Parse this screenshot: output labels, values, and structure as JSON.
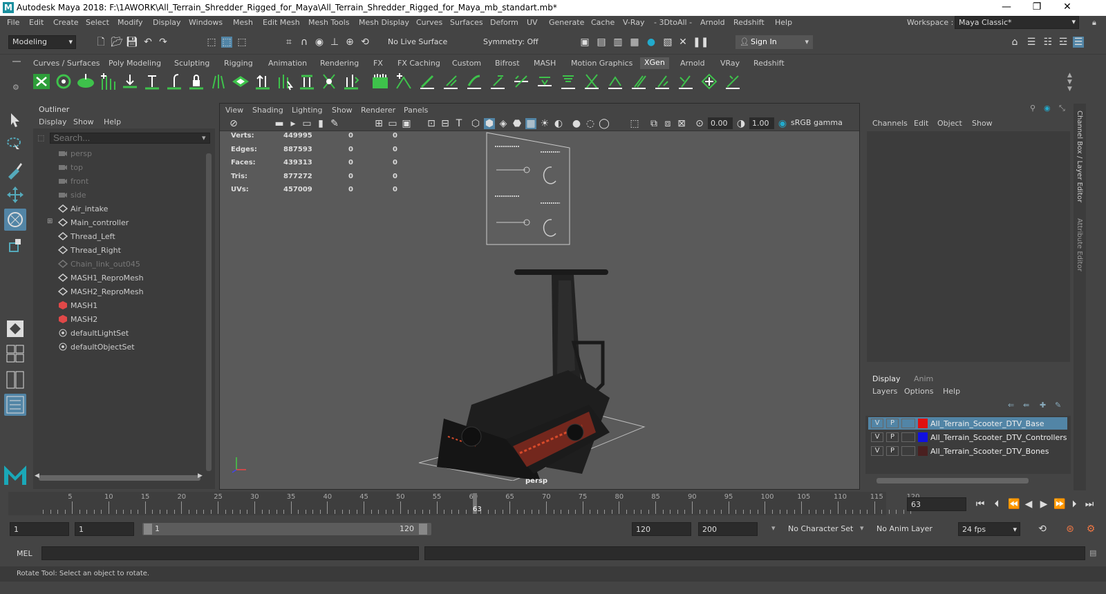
{
  "window": {
    "title": "Autodesk Maya 2018: F:\\1AWORK\\All_Terrain_Shredder_Rigged_for_Maya\\All_Terrain_Shredder_Rigged_for_Maya_mb_standart.mb*",
    "logo": "M",
    "minimize": "—",
    "restore": "❐",
    "close": "✕"
  },
  "menubar": {
    "items": [
      "File",
      "Edit",
      "Create",
      "Select",
      "Modify",
      "Display",
      "Windows",
      "Mesh",
      "Edit Mesh",
      "Mesh Tools",
      "Mesh Display",
      "Curves",
      "Surfaces",
      "Deform",
      "UV",
      "Generate",
      "Cache",
      "V-Ray",
      "- 3DtoAll -",
      "Arnold",
      "Redshift",
      "Help"
    ],
    "workspace_label": "Workspace :",
    "workspace_value": "Maya Classic*"
  },
  "toolbar": {
    "mode": "Modeling",
    "live_surface": "No Live Surface",
    "symmetry": "Symmetry: Off",
    "sign_in": "Sign In"
  },
  "shelf": {
    "tabs": [
      "Curves / Surfaces",
      "Poly Modeling",
      "Sculpting",
      "Rigging",
      "Animation",
      "Rendering",
      "FX",
      "FX Caching",
      "Custom",
      "Bifrost",
      "MASH",
      "Motion Graphics",
      "XGen",
      "Arnold",
      "VRay",
      "Redshift"
    ],
    "active": "XGen"
  },
  "outliner": {
    "title": "Outliner",
    "menu": [
      "Display",
      "Show",
      "Help"
    ],
    "search_placeholder": "Search...",
    "items": [
      {
        "label": "persp",
        "type": "camera",
        "dim": true
      },
      {
        "label": "top",
        "type": "camera",
        "dim": true
      },
      {
        "label": "front",
        "type": "camera",
        "dim": true
      },
      {
        "label": "side",
        "type": "camera",
        "dim": true
      },
      {
        "label": "Air_intake",
        "type": "mesh",
        "dim": false
      },
      {
        "label": "Main_controller",
        "type": "mesh",
        "dim": false,
        "expandable": true
      },
      {
        "label": "Thread_Left",
        "type": "mesh",
        "dim": false
      },
      {
        "label": "Thread_Right",
        "type": "mesh",
        "dim": false
      },
      {
        "label": "Chain_link_out045",
        "type": "mesh",
        "dim": true
      },
      {
        "label": "MASH1_ReproMesh",
        "type": "mesh",
        "dim": false
      },
      {
        "label": "MASH2_ReproMesh",
        "type": "mesh",
        "dim": false
      },
      {
        "label": "MASH1",
        "type": "mash",
        "dim": false
      },
      {
        "label": "MASH2",
        "type": "mash",
        "dim": false
      },
      {
        "label": "defaultLightSet",
        "type": "set",
        "dim": false
      },
      {
        "label": "defaultObjectSet",
        "type": "set",
        "dim": false
      }
    ]
  },
  "viewport": {
    "menu": [
      "View",
      "Shading",
      "Lighting",
      "Show",
      "Renderer",
      "Panels"
    ],
    "exposure": "0.00",
    "gamma": "1.00",
    "colorspace": "sRGB gamma",
    "camera": "persp",
    "stats": [
      {
        "label": "Verts:",
        "v1": "449995",
        "v2": "0",
        "v3": "0"
      },
      {
        "label": "Edges:",
        "v1": "887593",
        "v2": "0",
        "v3": "0"
      },
      {
        "label": "Faces:",
        "v1": "439313",
        "v2": "0",
        "v3": "0"
      },
      {
        "label": "Tris:",
        "v1": "877272",
        "v2": "0",
        "v3": "0"
      },
      {
        "label": "UVs:",
        "v1": "457009",
        "v2": "0",
        "v3": "0"
      }
    ]
  },
  "channelbox": {
    "menu": [
      "Channels",
      "Edit",
      "Object",
      "Show"
    ],
    "side_tabs": [
      "Channel Box / Layer Editor",
      "Attribute Editor"
    ]
  },
  "layers": {
    "tabs": [
      "Display",
      "Anim"
    ],
    "menu": [
      "Layers",
      "Options",
      "Help"
    ],
    "rows": [
      {
        "v": "V",
        "p": "P",
        "color": "#e01010",
        "name": "All_Terrain_Scooter_DTV_Base",
        "selected": true
      },
      {
        "v": "V",
        "p": "P",
        "color": "#1010e0",
        "name": "All_Terrain_Scooter_DTV_Controllers",
        "selected": false
      },
      {
        "v": "V",
        "p": "P",
        "color": "#4a2020",
        "name": "All_Terrain_Scooter_DTV_Bones",
        "selected": false
      }
    ]
  },
  "timeline": {
    "ticks": [
      "5",
      "10",
      "15",
      "20",
      "25",
      "30",
      "35",
      "40",
      "45",
      "50",
      "55",
      "60",
      "65",
      "70",
      "75",
      "80",
      "85",
      "90",
      "95",
      "100",
      "105",
      "110",
      "115",
      "120"
    ],
    "current": "63",
    "current_field": "63"
  },
  "range": {
    "start": "1",
    "anim_start": "1",
    "slider_start": "1",
    "slider_end": "120",
    "end": "120",
    "anim_end": "200",
    "character_set": "No Character Set",
    "anim_layer": "No Anim Layer",
    "fps": "24 fps"
  },
  "mel": {
    "label": "MEL"
  },
  "helpline": {
    "text": "Rotate Tool: Select an object to rotate."
  }
}
